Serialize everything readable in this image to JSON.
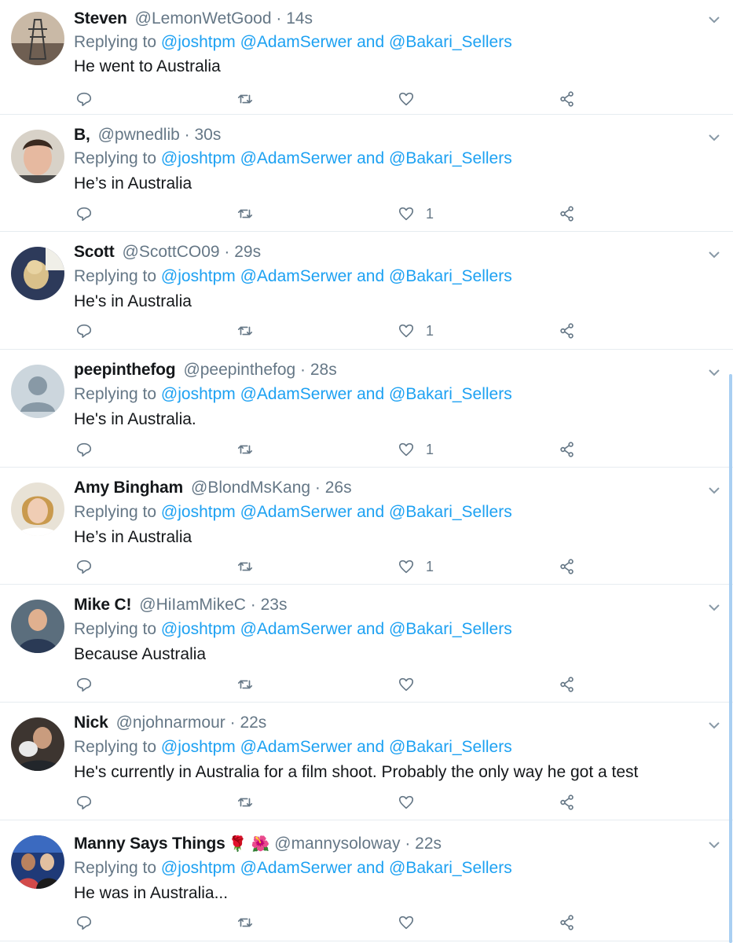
{
  "colors": {
    "link": "#1da1f2",
    "muted": "#657786",
    "text": "#14171a",
    "divider": "#e6ecf0",
    "scrollbar": "#a9cff2"
  },
  "icons": {
    "reply": "reply-icon",
    "retweet": "retweet-icon",
    "like": "heart-icon",
    "share": "share-icon",
    "menu": "chevron-down-icon"
  },
  "tweets": [
    {
      "name": "Steven",
      "emoji": "",
      "handle": "@LemonWetGood",
      "time": "· 14s",
      "replying_prefix": "Replying to ",
      "replying_to": "@joshtpm @AdamSerwer",
      "replying_and": " and ",
      "replying_last": "@Bakari_Sellers",
      "text": "He went to Australia",
      "likes": ""
    },
    {
      "name": "B,",
      "emoji": "",
      "handle": "@pwnedlib",
      "time": "· 30s",
      "replying_prefix": "Replying to ",
      "replying_to": "@joshtpm @AdamSerwer",
      "replying_and": " and ",
      "replying_last": "@Bakari_Sellers",
      "text": "He’s in Australia",
      "likes": "1"
    },
    {
      "name": "Scott",
      "emoji": "",
      "handle": "@ScottCO09",
      "time": "· 29s",
      "replying_prefix": "Replying to ",
      "replying_to": "@joshtpm @AdamSerwer",
      "replying_and": " and ",
      "replying_last": "@Bakari_Sellers",
      "text": "He's in Australia",
      "likes": "1"
    },
    {
      "name": "peepinthefog",
      "emoji": "",
      "handle": "@peepinthefog",
      "time": "· 28s",
      "replying_prefix": "Replying to ",
      "replying_to": "@joshtpm @AdamSerwer",
      "replying_and": " and ",
      "replying_last": "@Bakari_Sellers",
      "text": "He's in Australia.",
      "likes": "1"
    },
    {
      "name": "Amy Bingham",
      "emoji": "",
      "handle": "@BlondMsKang",
      "time": "· 26s",
      "replying_prefix": "Replying to ",
      "replying_to": "@joshtpm @AdamSerwer",
      "replying_and": " and ",
      "replying_last": "@Bakari_Sellers",
      "text": "He’s in Australia",
      "likes": "1"
    },
    {
      "name": "Mike C!",
      "emoji": "",
      "handle": "@HiIamMikeC",
      "time": "· 23s",
      "replying_prefix": "Replying to ",
      "replying_to": "@joshtpm @AdamSerwer",
      "replying_and": " and ",
      "replying_last": "@Bakari_Sellers",
      "text": "Because Australia",
      "likes": ""
    },
    {
      "name": "Nick",
      "emoji": "",
      "handle": "@njohnarmour",
      "time": "· 22s",
      "replying_prefix": "Replying to ",
      "replying_to": "@joshtpm @AdamSerwer",
      "replying_and": " and ",
      "replying_last": "@Bakari_Sellers",
      "text": "He's currently in Australia for a film shoot. Probably the only way he got a test",
      "likes": ""
    },
    {
      "name": "Manny Says Things",
      "emoji": "🌹 🌺",
      "handle": "@mannysoloway",
      "time": "· 22s",
      "replying_prefix": "Replying to ",
      "replying_to": "@joshtpm @AdamSerwer",
      "replying_and": " and ",
      "replying_last": "@Bakari_Sellers",
      "text": "He was in Australia...",
      "likes": ""
    }
  ]
}
